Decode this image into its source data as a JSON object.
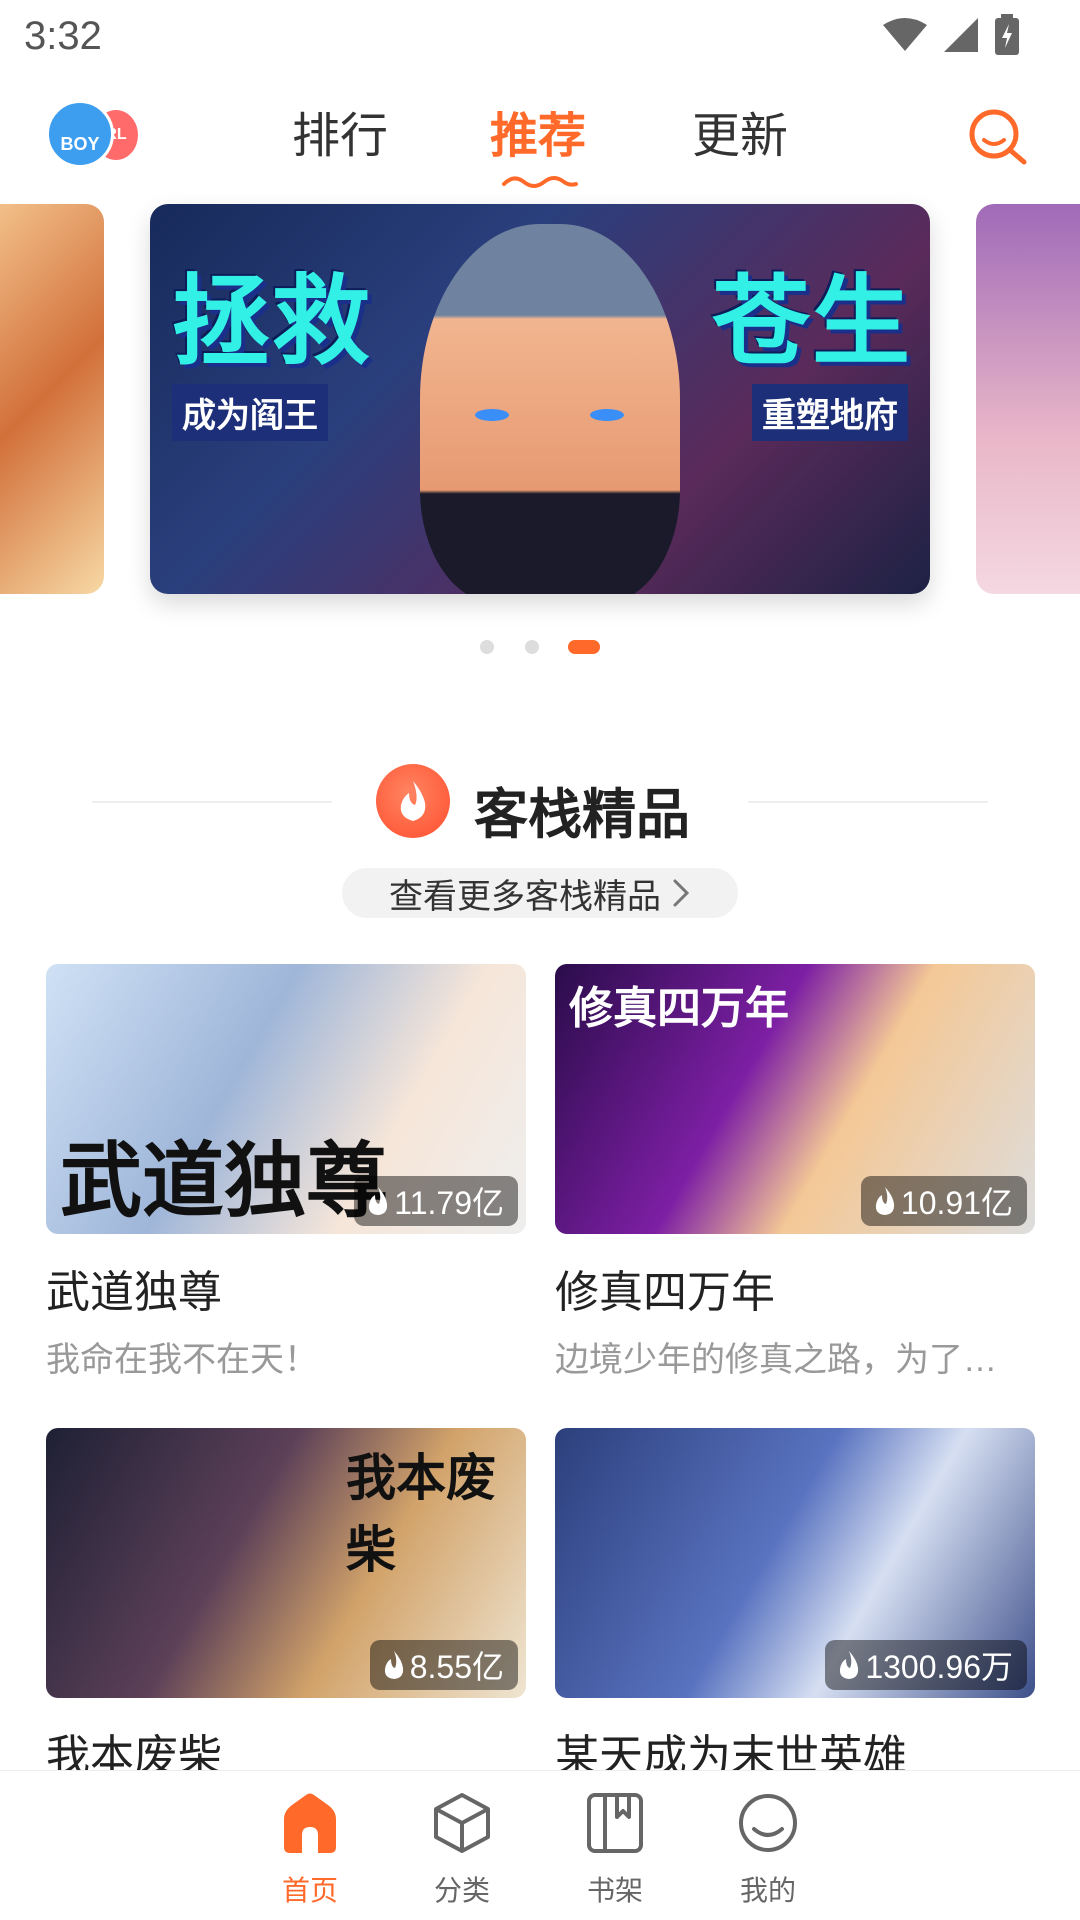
{
  "status_bar": {
    "time": "3:32"
  },
  "header": {
    "gender_switch": {
      "boy_label": "BOY",
      "girl_label": "RL"
    },
    "tabs": [
      {
        "label": "排行"
      },
      {
        "label": "推荐"
      },
      {
        "label": "更新"
      }
    ],
    "active_tab": "推荐",
    "accent_color": "#ff6a2a"
  },
  "banner": {
    "title_left": "拯救",
    "title_right": "苍生",
    "subtitle_left": "成为阎王",
    "subtitle_right": "重塑地府",
    "active_slide": 3,
    "slide_count": 3
  },
  "section": {
    "title": "客栈精品",
    "more_label": "查看更多客栈精品"
  },
  "comics": [
    {
      "title": "武道独尊",
      "desc": "我命在我不在天！",
      "heat": "11.79亿",
      "cover_text": "武道独尊"
    },
    {
      "title": "修真四万年",
      "desc": "边境少年的修真之路，为了…",
      "heat": "10.91亿",
      "cover_text": "修真四万年"
    },
    {
      "title": "我本废柴",
      "desc": "",
      "heat": "8.55亿",
      "cover_text": "我本废柴"
    },
    {
      "title": "某天成为末世英雄",
      "desc": "",
      "heat": "1300.96万",
      "cover_text": ""
    }
  ],
  "bottom_nav": [
    {
      "label": "首页",
      "icon": "home-icon",
      "active": true
    },
    {
      "label": "分类",
      "icon": "cube-icon",
      "active": false
    },
    {
      "label": "书架",
      "icon": "bookshelf-icon",
      "active": false
    },
    {
      "label": "我的",
      "icon": "smile-icon",
      "active": false
    }
  ]
}
